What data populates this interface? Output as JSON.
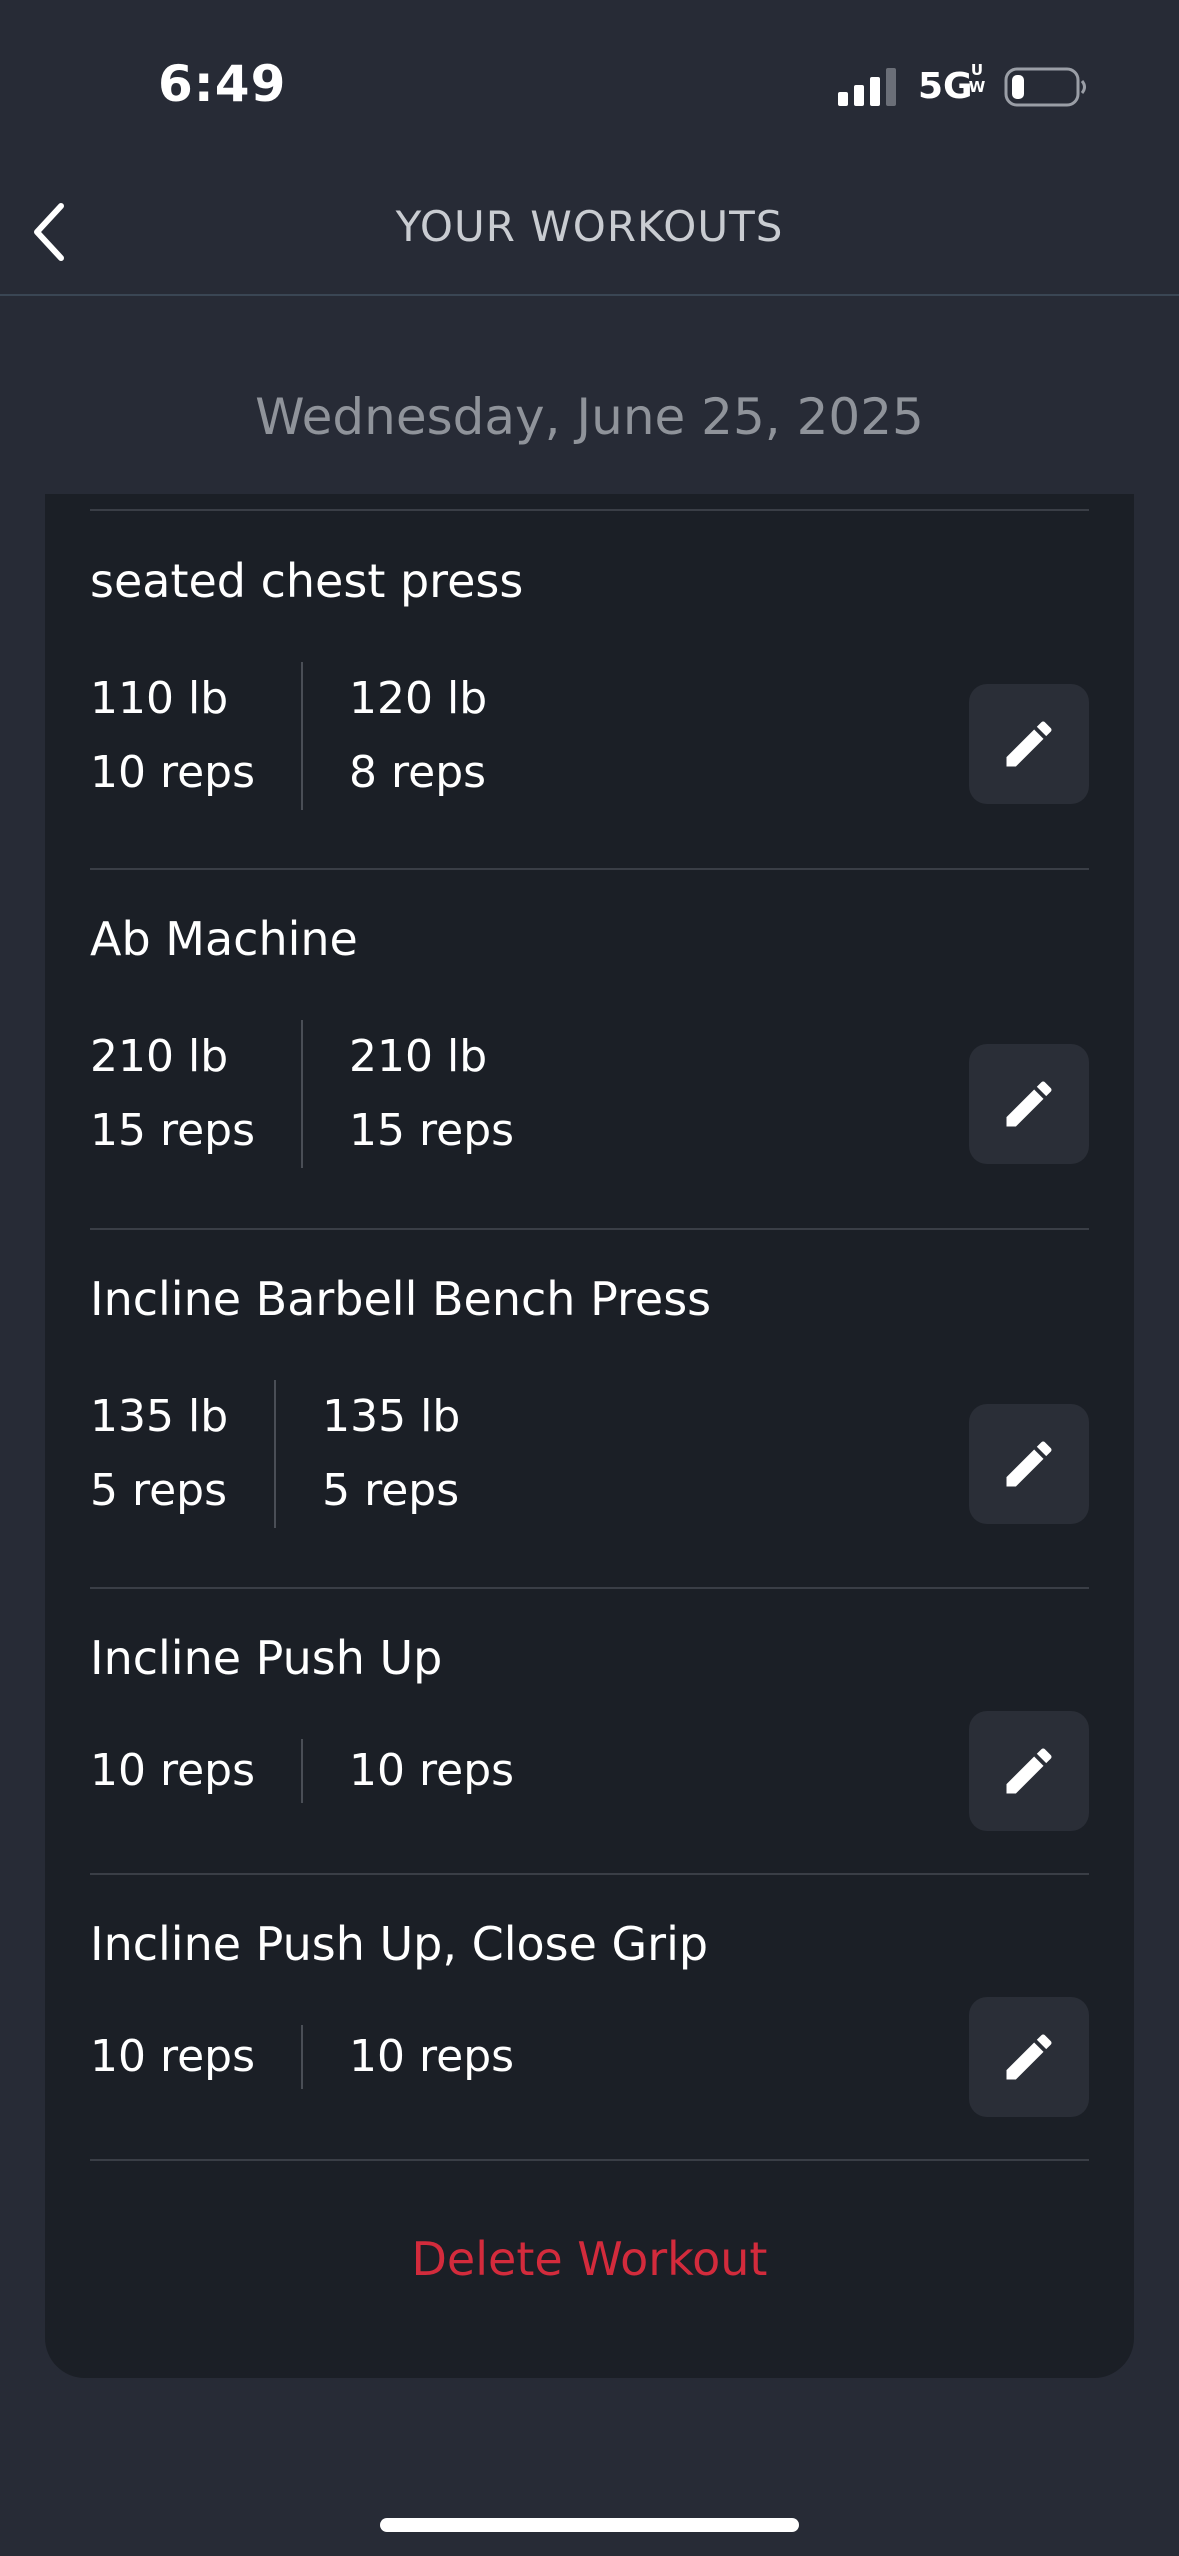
{
  "status_bar": {
    "time": "6:49",
    "network": "5G",
    "network_sub_top": "U",
    "network_sub_bottom": "W",
    "signal_icon": "signal-bars-icon",
    "battery_icon": "battery-low-icon"
  },
  "header": {
    "title": "YOUR WORKOUTS",
    "back_icon": "chevron-left-icon"
  },
  "date": "Wednesday, June 25, 2025",
  "exercises": [
    {
      "name": "seated chest press",
      "sets": [
        {
          "weight": "110 lb",
          "reps": "10 reps"
        },
        {
          "weight": "120 lb",
          "reps": "8 reps"
        }
      ]
    },
    {
      "name": "Ab Machine",
      "sets": [
        {
          "weight": "210 lb",
          "reps": "15 reps"
        },
        {
          "weight": "210 lb",
          "reps": "15 reps"
        }
      ]
    },
    {
      "name": "Incline Barbell Bench Press",
      "sets": [
        {
          "weight": "135 lb",
          "reps": "5 reps"
        },
        {
          "weight": "135 lb",
          "reps": "5 reps"
        }
      ]
    },
    {
      "name": "Incline Push Up",
      "sets": [
        {
          "reps": "10 reps"
        },
        {
          "reps": "10 reps"
        }
      ]
    },
    {
      "name": "Incline Push Up, Close Grip",
      "sets": [
        {
          "reps": "10 reps"
        },
        {
          "reps": "10 reps"
        }
      ]
    }
  ],
  "edit_icon": "pencil-icon",
  "delete_label": "Delete Workout",
  "colors": {
    "background": "#272b36",
    "card": "#1b1f26",
    "edit_button": "#2a2e37",
    "delete": "#d32b3c",
    "date_text": "#8f939a",
    "header_text": "#c9ccd1"
  }
}
